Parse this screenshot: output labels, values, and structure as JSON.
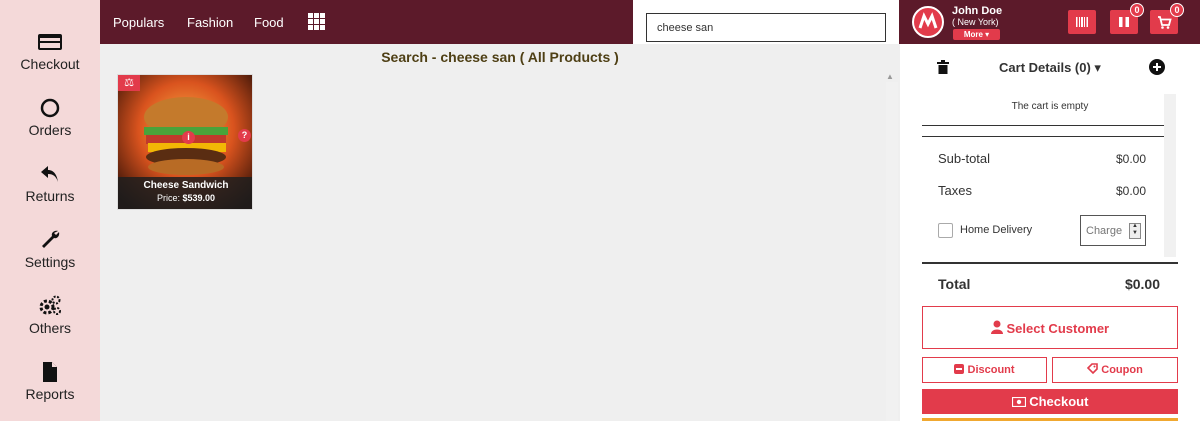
{
  "sidebar": {
    "items": [
      {
        "label": "Checkout"
      },
      {
        "label": "Orders"
      },
      {
        "label": "Returns"
      },
      {
        "label": "Settings"
      },
      {
        "label": "Others"
      },
      {
        "label": "Reports"
      }
    ]
  },
  "topbar": {
    "nav": [
      "Populars",
      "Fashion",
      "Food"
    ],
    "search": {
      "value": "cheese san",
      "placeholder": ""
    },
    "user": {
      "name": "John Doe",
      "location": "( New York)",
      "more_label": "More"
    },
    "badges": {
      "hold": "0",
      "cart": "0"
    }
  },
  "main": {
    "search_title": "Search - cheese san ( All Products )",
    "products": [
      {
        "name": "Cheese Sandwich",
        "price_label": "Price:",
        "price": "$539.00"
      }
    ]
  },
  "cart": {
    "title": "Cart Details (0)",
    "empty_text": "The cart is empty",
    "subtotal_label": "Sub-total",
    "subtotal_value": "$0.00",
    "taxes_label": "Taxes",
    "taxes_value": "$0.00",
    "home_delivery_label": "Home Delivery",
    "charge_placeholder": "Charge",
    "total_label": "Total",
    "total_value": "$0.00",
    "select_customer_label": "Select Customer",
    "discount_label": "Discount",
    "coupon_label": "Coupon",
    "checkout_label": "Checkout"
  },
  "colors": {
    "topbar": "#5c1a2a",
    "accent": "#e23b4b",
    "sidebar": "#f4d9d9",
    "title_text": "#4e3f14"
  }
}
